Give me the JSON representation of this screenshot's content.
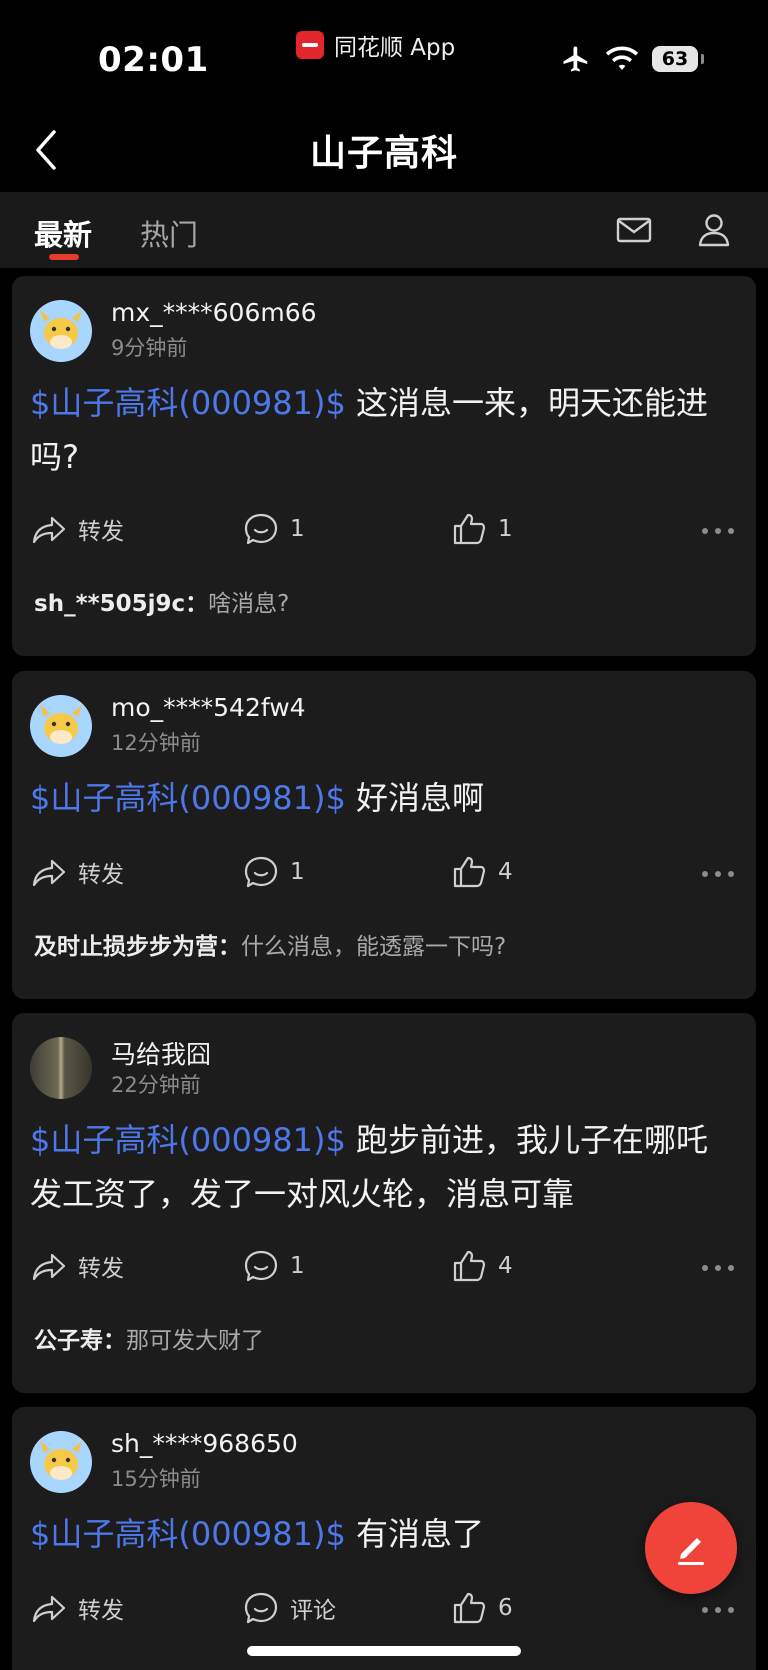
{
  "status_bar": {
    "time": "02:01",
    "app_name": "同花顺 App",
    "battery": "63"
  },
  "nav": {
    "title": "山子高科"
  },
  "tabs": [
    {
      "label": "最新",
      "active": true
    },
    {
      "label": "热门",
      "active": false
    }
  ],
  "posts": [
    {
      "username": "mx_****606m66",
      "time": "9分钟前",
      "stock_tag": "$山子高科(000981)$",
      "text": " 这消息一来，明天还能进吗?",
      "forward_label": "转发",
      "comment_count": "1",
      "like_count": "1",
      "reply_user": "sh_**505j9c：",
      "reply_text": "啥消息?"
    },
    {
      "username": "mo_****542fw4",
      "time": "12分钟前",
      "stock_tag": "$山子高科(000981)$",
      "text": " 好消息啊",
      "forward_label": "转发",
      "comment_count": "1",
      "like_count": "4",
      "reply_user": "及时止损步步为营：",
      "reply_text": "什么消息，能透露一下吗?"
    },
    {
      "username": "马给我囧",
      "time": "22分钟前",
      "stock_tag": "$山子高科(000981)$",
      "text": " 跑步前进，我儿子在哪吒发工资了，发了一对风火轮，消息可靠",
      "forward_label": "转发",
      "comment_count": "1",
      "like_count": "4",
      "reply_user": "公子寿：",
      "reply_text": "那可发大财了"
    },
    {
      "username": "sh_****968650",
      "time": "15分钟前",
      "stock_tag": "$山子高科(000981)$",
      "text": " 有消息了",
      "forward_label": "转发",
      "comment_count": "评论",
      "like_count": "6"
    }
  ],
  "colors": {
    "accent": "#e93a2f",
    "stock_tag": "#4e78ea",
    "card_bg": "#1c1c1c",
    "fab": "#f0443a"
  },
  "icons": [
    "back-icon",
    "mail-icon",
    "profile-icon",
    "share-icon",
    "comment-icon",
    "like-icon",
    "more-icon",
    "edit-icon",
    "airplane-icon",
    "wifi-icon"
  ]
}
